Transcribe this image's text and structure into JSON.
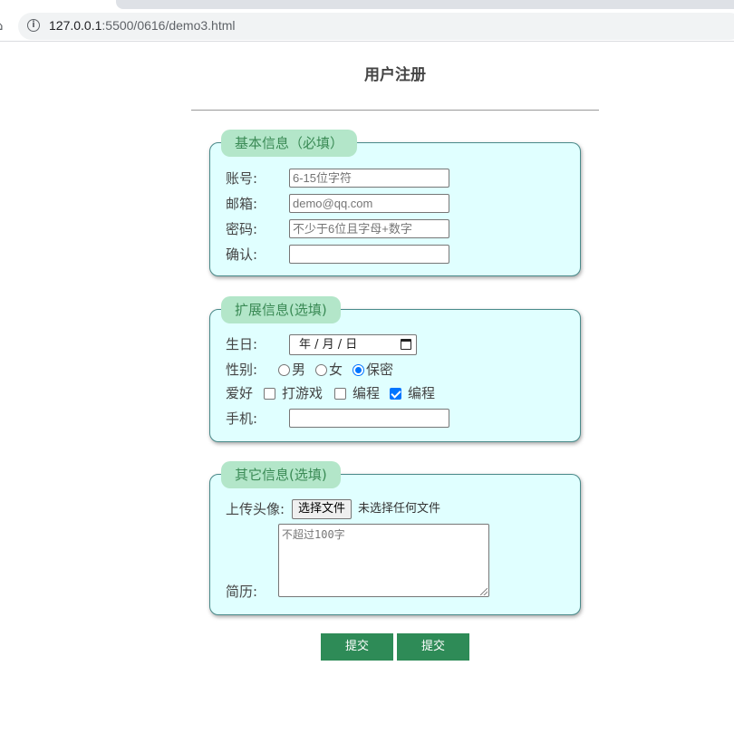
{
  "browser": {
    "url_host": "127.0.0.1",
    "url_path": ":5500/0616/demo3.html"
  },
  "page": {
    "title": "用户注册"
  },
  "basic": {
    "legend": "基本信息（必填）",
    "account_label": "账号:",
    "account_placeholder": "6-15位字符",
    "email_label": "邮箱:",
    "email_placeholder": "demo@qq.com",
    "password_label": "密码:",
    "password_placeholder": "不少于6位且字母+数字",
    "confirm_label": "确认:"
  },
  "extended": {
    "legend": "扩展信息(选填)",
    "birthday_label": "生日:",
    "birthday_value": "年 / 月 / 日",
    "gender_label": "性别:",
    "gender_options": [
      "男",
      "女",
      "保密"
    ],
    "gender_selected": "保密",
    "hobby_label": "爱好",
    "hobby_options": [
      "打游戏",
      "编程",
      "编程"
    ],
    "hobby_checked": [
      false,
      false,
      true
    ],
    "phone_label": "手机:"
  },
  "other": {
    "legend": "其它信息(选填)",
    "avatar_label": "上传头像:",
    "file_button": "选择文件",
    "file_status": "未选择任何文件",
    "resume_label": "简历:",
    "resume_placeholder": "不超过100字"
  },
  "buttons": [
    "提交",
    "提交"
  ],
  "colors": {
    "section_bg": "#e0ffff",
    "legend_bg": "#b3e6c9",
    "button_bg": "#2e8b57",
    "radio_accent": "#0075ff"
  }
}
